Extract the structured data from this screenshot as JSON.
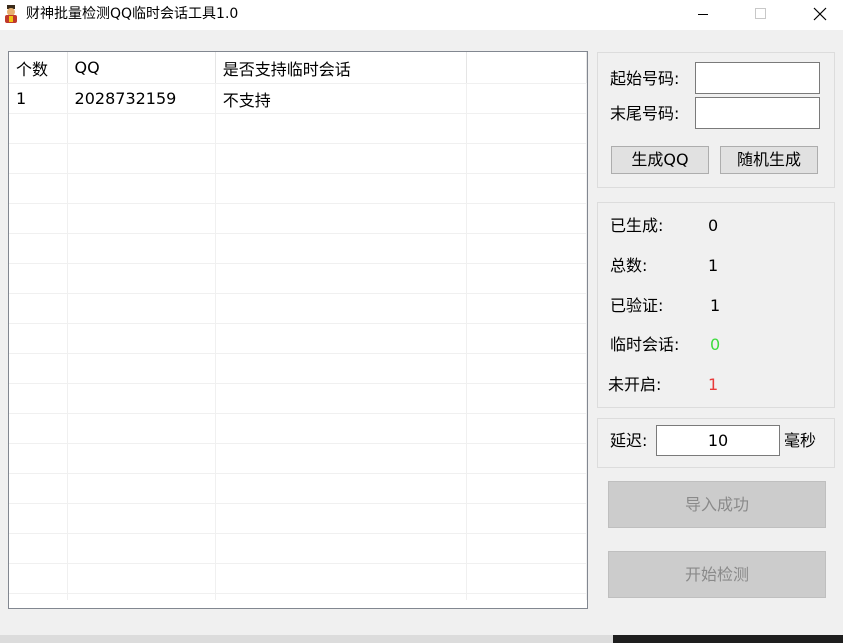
{
  "window": {
    "title": "财神批量检测QQ临时会话工具1.0",
    "icon": "god-of-wealth-icon"
  },
  "controls": {
    "minimize": "minimize-icon",
    "maximize": "maximize-icon",
    "close": "close-icon"
  },
  "list": {
    "columns": [
      "个数",
      "QQ",
      "是否支持临时会话",
      ""
    ],
    "rows": [
      [
        "1",
        "2028732159",
        "不支持",
        ""
      ]
    ]
  },
  "range": {
    "start_label": "起始号码:",
    "start_value": "",
    "end_label": "末尾号码:",
    "end_value": "",
    "generate_button": "生成QQ",
    "random_button": "随机生成"
  },
  "stats": {
    "generated_label": "已生成:",
    "generated_value": "0",
    "total_label": "总数:",
    "total_value": "1",
    "verified_label": "已验证:",
    "verified_value": "1",
    "temp_session_label": "临时会话:",
    "temp_session_value": "0",
    "not_enabled_label": "未开启:",
    "not_enabled_value": "1"
  },
  "delay": {
    "label": "延迟:",
    "value": "10",
    "unit": "毫秒"
  },
  "actions": {
    "import_button": "导入成功",
    "start_button": "开始检测"
  },
  "colors": {
    "temp_session_value": "#3ddc3d",
    "not_enabled_value": "#e83a3a"
  }
}
